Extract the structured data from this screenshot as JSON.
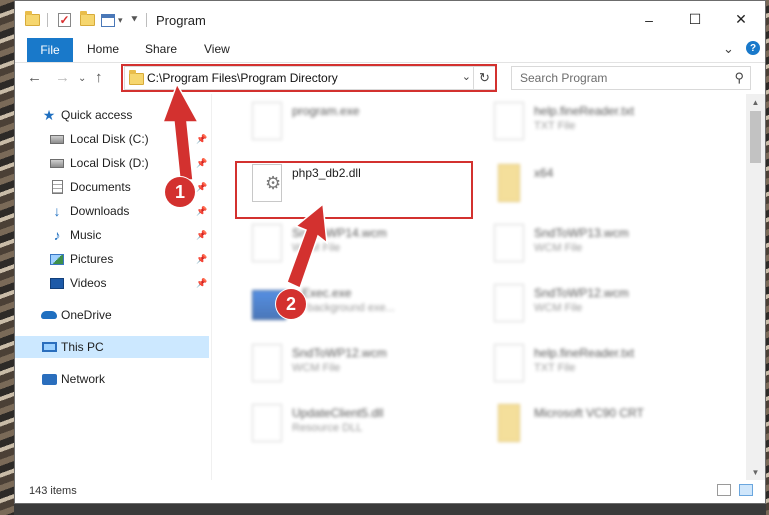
{
  "window": {
    "title": "Program",
    "controls": {
      "minimize": "–",
      "maximize": "☐",
      "close": "✕"
    }
  },
  "ribbon": {
    "tabs": [
      "File",
      "Home",
      "Share",
      "View"
    ],
    "expand_icon": "chevron-down-icon",
    "help_label": "?"
  },
  "address_bar": {
    "path": "C:\\Program Files\\Program Directory",
    "refresh_icon": "↻"
  },
  "search": {
    "placeholder": "Search Program"
  },
  "sidebar": {
    "items": [
      {
        "label": "Quick access",
        "icon": "star-icon"
      },
      {
        "label": "Local Disk (C:)",
        "icon": "drive-icon",
        "pinned": true
      },
      {
        "label": "Local Disk (D:)",
        "icon": "drive-icon",
        "pinned": true
      },
      {
        "label": "Documents",
        "icon": "document-icon",
        "pinned": true
      },
      {
        "label": "Downloads",
        "icon": "download-icon",
        "pinned": true
      },
      {
        "label": "Music",
        "icon": "music-icon",
        "pinned": true
      },
      {
        "label": "Pictures",
        "icon": "pictures-icon",
        "pinned": true
      },
      {
        "label": "Videos",
        "icon": "videos-icon",
        "pinned": true
      },
      {
        "label": "OneDrive",
        "icon": "cloud-icon"
      },
      {
        "label": "This PC",
        "icon": "computer-icon",
        "selected": true
      },
      {
        "label": "Network",
        "icon": "network-icon"
      }
    ]
  },
  "files": [
    {
      "name": "program.exe",
      "type": ""
    },
    {
      "name": "help.fineReader.txt",
      "type": "TXT File"
    },
    {
      "name": "php3_db2.dll",
      "type": ""
    },
    {
      "name": "x64",
      "type": ""
    },
    {
      "name": "SndToWP14.wcm",
      "type": "WCM File"
    },
    {
      "name": "SndToWP13.wcm",
      "type": "WCM File"
    },
    {
      "name": "...Exec.exe",
      "type": "...f background exe..."
    },
    {
      "name": "SndToWP12.wcm",
      "type": "WCM File"
    },
    {
      "name": "SndToWP12.wcm",
      "type": "WCM File"
    },
    {
      "name": "help.fineReader.txt",
      "type": "TXT File"
    },
    {
      "name": "UpdateClient5.dll",
      "type": "Resource DLL"
    },
    {
      "name": "Microsoft VC90 CRT",
      "type": ""
    }
  ],
  "status": {
    "item_count": "143 items"
  },
  "annotations": {
    "step1": "1",
    "step2": "2",
    "accent": "#d3312f"
  }
}
